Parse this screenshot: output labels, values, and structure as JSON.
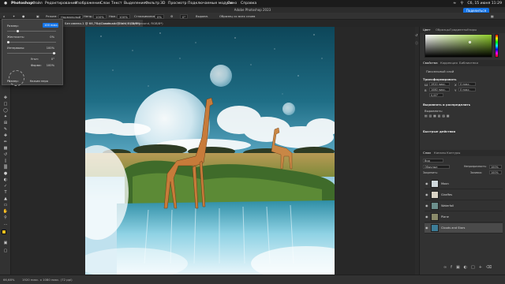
{
  "menubar": {
    "app_name": "Photoshop",
    "items": [
      "Файл",
      "Редактирование",
      "Изображение",
      "Слои",
      "Текст",
      "Выделение",
      "Фильтр",
      "3D",
      "Просмотр",
      "Подключаемые модули",
      "Окно",
      "Справка"
    ],
    "clock": "Сб, 15 июня 11:29"
  },
  "titlebar": {
    "title": "Adobe Photoshop 2023",
    "share_label": "Поделиться"
  },
  "optionsbar": {
    "mode_label": "Режим:",
    "mode_value": "Нормальный",
    "opacity_label": "Непр.:",
    "opacity_value": "100%",
    "flow_label": "Наж.:",
    "flow_value": "100%",
    "smoothing_label": "Сглаживание:",
    "smoothing_value": "0%",
    "angle_value": "0°",
    "pattern_label": "Образец со всех слоев",
    "aligned_label": "Выравн."
  },
  "tabs": [
    {
      "label": "Без имени-1 @ 66,7% (Clouds and Stars, RGB/8*)"
    },
    {
      "label": "Без имени-1 @ 100% (Background, RGB/8*)"
    }
  ],
  "brush_popup": {
    "size_label": "Размер:",
    "size_value": "100 пикс.",
    "hardness_label": "Жесткость:",
    "hardness_value": "0%",
    "spacing_label": "Интервалы:",
    "spacing_value": "100%",
    "angle_label": "Угол:",
    "angle_value": "0°",
    "roundness_label": "Форма:",
    "roundness_value": "100%",
    "pen_label": "Размер:",
    "pen_value": "Нажим пера"
  },
  "color_panel": {
    "tabs": [
      "Цвет",
      "Образцы",
      "Градиенты",
      "Узоры"
    ],
    "accent": "#8fcc2b"
  },
  "properties_panel": {
    "tabs": [
      "Свойства",
      "Коррекция",
      "Библиотеки"
    ],
    "layer_kind": "Пиксельный слой",
    "transform_header": "Трансформировать",
    "w_label": "Ш",
    "w_value": "1920 пикс.",
    "h_label": "В",
    "h_value": "1080 пикс.",
    "x_label": "X",
    "x_value": "0 пикс.",
    "y_label": "Y",
    "y_value": "0 пикс.",
    "angle_value": "0,00°",
    "align_header": "Выровнять и распределить",
    "align_label": "Выровнять:",
    "quick_header": "Быстрые действия"
  },
  "layers_panel": {
    "tabs": [
      "Слои",
      "Каналы",
      "Контуры"
    ],
    "filter_kind": "Вид",
    "blend_mode": "Обычные",
    "opacity_label": "Непрозрачность:",
    "opacity_value": "100%",
    "lock_label": "Закрепить:",
    "fill_label": "Заливка:",
    "fill_value": "100%",
    "layers": [
      {
        "name": "Moon"
      },
      {
        "name": "Giraffes"
      },
      {
        "name": "Waterfall"
      },
      {
        "name": "Plane"
      },
      {
        "name": "Clouds and Stars"
      }
    ]
  },
  "statusbar": {
    "zoom": "66,68%",
    "doc_size": "1920 пикс. х 1080 пикс. (72 ppi)"
  }
}
